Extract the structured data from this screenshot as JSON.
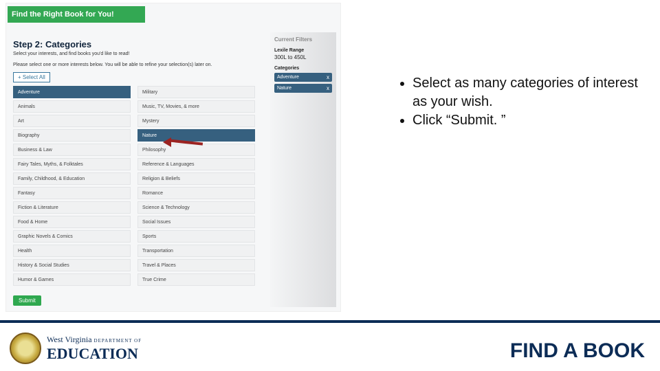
{
  "banner": "Find the Right Book for You!",
  "step_title": "Step 2: Categories",
  "step_sub1": "Select your interests, and find books you'd like to read!",
  "step_sub2": "Please select one or more interests below. You will be able to refine your selection(s) later on.",
  "select_all": "+ Select All",
  "categories_col1": [
    {
      "label": "Adventure",
      "sel": true
    },
    {
      "label": "Animals",
      "sel": false
    },
    {
      "label": "Art",
      "sel": false
    },
    {
      "label": "Biography",
      "sel": false
    },
    {
      "label": "Business & Law",
      "sel": false
    },
    {
      "label": "Fairy Tales, Myths, & Folktales",
      "sel": false
    },
    {
      "label": "Family, Childhood, & Education",
      "sel": false
    },
    {
      "label": "Fantasy",
      "sel": false
    },
    {
      "label": "Fiction & Literature",
      "sel": false
    },
    {
      "label": "Food & Home",
      "sel": false
    },
    {
      "label": "Graphic Novels & Comics",
      "sel": false
    },
    {
      "label": "Health",
      "sel": false
    },
    {
      "label": "History & Social Studies",
      "sel": false
    },
    {
      "label": "Humor & Games",
      "sel": false
    }
  ],
  "categories_col2": [
    {
      "label": "Military",
      "sel": false
    },
    {
      "label": "Music, TV, Movies, & more",
      "sel": false
    },
    {
      "label": "Mystery",
      "sel": false
    },
    {
      "label": "Nature",
      "sel": true
    },
    {
      "label": "Philosophy",
      "sel": false
    },
    {
      "label": "Reference & Languages",
      "sel": false
    },
    {
      "label": "Religion & Beliefs",
      "sel": false
    },
    {
      "label": "Romance",
      "sel": false
    },
    {
      "label": "Science & Technology",
      "sel": false
    },
    {
      "label": "Social Issues",
      "sel": false
    },
    {
      "label": "Sports",
      "sel": false
    },
    {
      "label": "Transportation",
      "sel": false
    },
    {
      "label": "Travel & Places",
      "sel": false
    },
    {
      "label": "True Crime",
      "sel": false
    }
  ],
  "submit": "Submit",
  "filters": {
    "title": "Current Filters",
    "range_label": "Lexile Range",
    "range_value": "300L to 450L",
    "cat_label": "Categories",
    "tags": [
      "Adventure",
      "Nature"
    ],
    "x": "x"
  },
  "bullets": [
    "Select as many categories of interest as your wish.",
    "Click “Submit. ”"
  ],
  "logo": {
    "line1a": "West Virginia",
    "line1b": "DEPARTMENT OF",
    "line2": "EDUCATION"
  },
  "title": "FIND A BOOK"
}
